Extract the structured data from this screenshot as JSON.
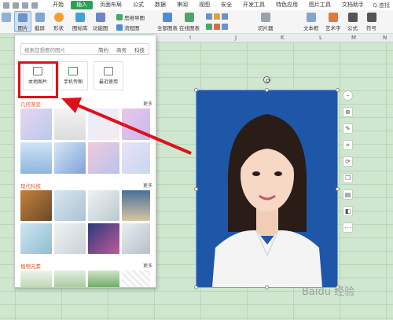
{
  "menubar": {
    "tabs": [
      "开始",
      "插入",
      "页面布局",
      "公式",
      "数据",
      "审阅",
      "视图",
      "安全",
      "开发工具",
      "特色应用",
      "图片工具",
      "文档助手"
    ],
    "active_tab": "插入",
    "search_label": "Q.查找"
  },
  "ribbon": {
    "picture_label": "图片",
    "screenshot_label": "截屏",
    "shapes_label": "形状",
    "gallery_label": "图标库",
    "function_label": "功能图",
    "mindmap_label": "思维导图",
    "flowchart_label": "流程图",
    "all_charts_label": "全部图表",
    "online_charts_label": "在线图表",
    "slicer_label": "切片器",
    "textbox_label": "文本框",
    "wordart_label": "艺术字",
    "formula_label": "公式",
    "symbol_label": "符号"
  },
  "sheet": {
    "columns": [
      "I",
      "J",
      "K",
      "L",
      "M",
      "N"
    ]
  },
  "panel": {
    "search_placeholder": "搜索您想要的图片",
    "chips": [
      "简约",
      "商务",
      "科技"
    ],
    "local_picture": "本地图片",
    "phone_picture": "手机传图",
    "recent_use": "最近使用",
    "sections": [
      {
        "title": "几何渐变",
        "more": "更多"
      },
      {
        "title": "现代科技",
        "more": "更多"
      },
      {
        "title": "植物元素",
        "more": "更多"
      }
    ]
  },
  "watermark": {
    "text": "Baidu 经验"
  },
  "colors": {
    "active_tab": "#2e9f57",
    "photo_background": "#1f57a8",
    "highlight": "#e0101a",
    "section_title": "#e05a2b"
  }
}
